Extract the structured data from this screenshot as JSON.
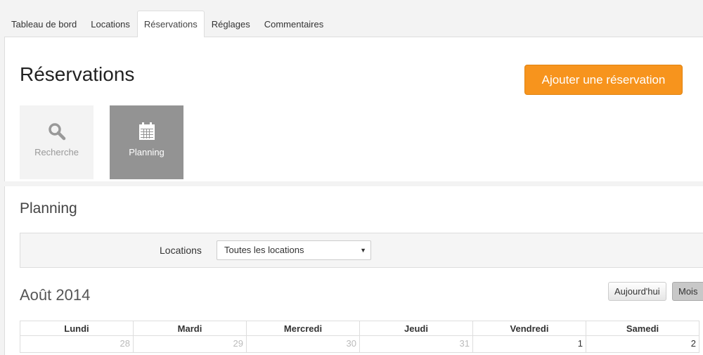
{
  "tabs": [
    "Tableau de bord",
    "Locations",
    "Réservations",
    "Réglages",
    "Commentaires"
  ],
  "active_tab": "Réservations",
  "page_title": "Réservations",
  "add_button": "Ajouter une réservation",
  "tiles": [
    {
      "label": "Recherche",
      "icon": "search-icon"
    },
    {
      "label": "Planning",
      "icon": "calendar-icon",
      "active": true
    }
  ],
  "planning": {
    "title": "Planning",
    "filter_label": "Locations",
    "filter_value": "Toutes les locations"
  },
  "calendar": {
    "month": "Août 2014",
    "today_button": "Aujourd'hui",
    "month_button": "Mois",
    "days": [
      "Lundi",
      "Mardi",
      "Mercredi",
      "Jeudi",
      "Vendredi",
      "Samedi"
    ],
    "first_row": [
      "28",
      "29",
      "30",
      "31",
      "1",
      "2"
    ]
  },
  "colors": {
    "accent": "#f7941d",
    "tile_active": "#939393"
  }
}
